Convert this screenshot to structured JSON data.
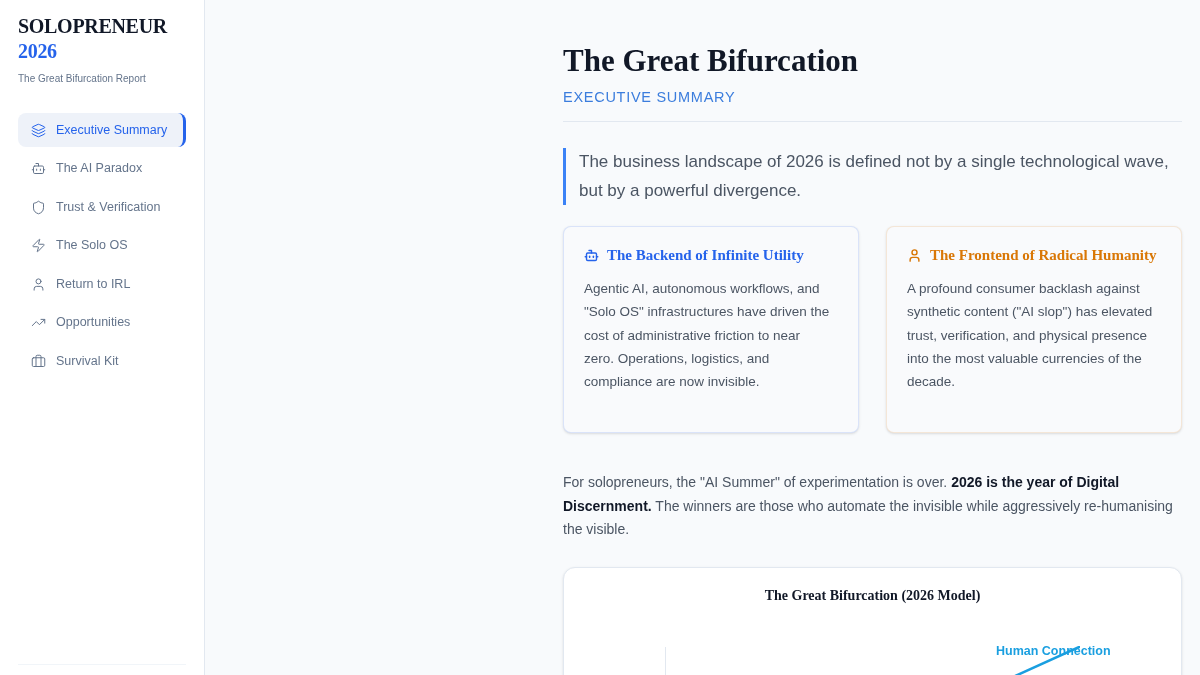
{
  "sidebar": {
    "logo": {
      "title": "SOLOPRENEUR",
      "year": "2026"
    },
    "subtitle": "The Great Bifurcation Report",
    "nav": [
      {
        "label": "Executive Summary",
        "selected": true
      },
      {
        "label": "The AI Paradox",
        "selected": false
      },
      {
        "label": "Trust & Verification",
        "selected": false
      },
      {
        "label": "The Solo OS",
        "selected": false
      },
      {
        "label": "Return to IRL",
        "selected": false
      },
      {
        "label": "Opportunities",
        "selected": false
      },
      {
        "label": "Survival Kit",
        "selected": false
      }
    ]
  },
  "main": {
    "title": "The Great Bifurcation",
    "section_label": "EXECUTIVE SUMMARY",
    "lead": "The business landscape of 2026 is defined not by a single technological wave, but by a powerful divergence.",
    "cards": [
      {
        "title": "The Backend of Infinite Utility",
        "color": "#2563eb",
        "body": "Agentic AI, autonomous workflows, and \"Solo OS\" infrastructures have driven the cost of administrative friction to near zero. Operations, logistics, and compliance are now invisible."
      },
      {
        "title": "The Frontend of Radical Humanity",
        "color": "#d97706",
        "body": "A profound consumer backlash against synthetic content (\"AI slop\") has elevated trust, verification, and physical presence into the most valuable currencies of the decade."
      }
    ],
    "paragraph": "For solopreneurs, the \"AI Summer\" of experimentation is over. **2026 is the year of Digital Discernment.** The winners are those who automate the invisible while aggressively re-humanising the visible.",
    "chart": {
      "title": "The Great Bifurcation (2026 Model)",
      "line_label": "Human Connection"
    }
  }
}
